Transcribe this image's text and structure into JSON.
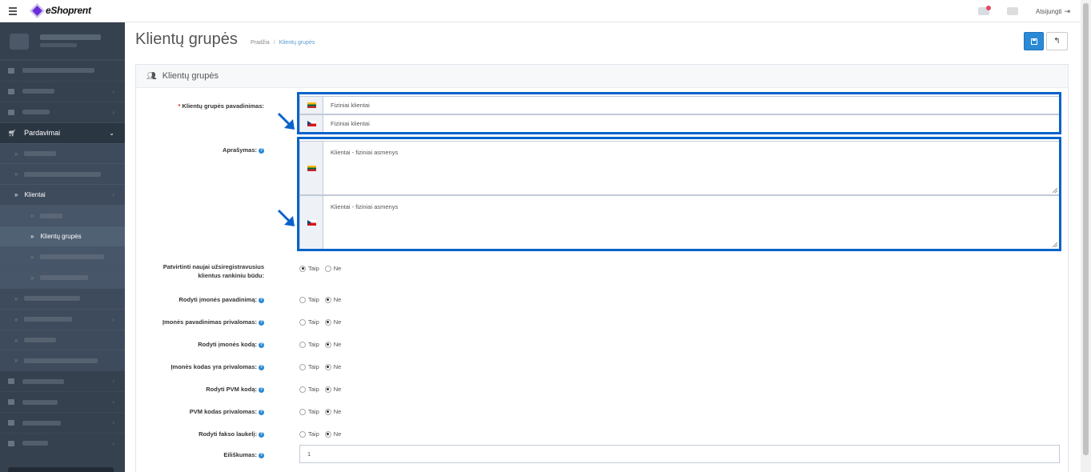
{
  "app": {
    "logo_text": "eShoprent",
    "logout_label": "Atsijungti"
  },
  "sidebar": {
    "open_section_label": "Pardavimai",
    "clients_label": "Klientai",
    "active_item_label": "Klientų grupės"
  },
  "page": {
    "title": "Klientų grupės",
    "breadcrumb": {
      "home": "Pradžia",
      "separator": "/",
      "current": "Klientų grupės"
    }
  },
  "panel": {
    "title": "Klientų grupės"
  },
  "form": {
    "name_label": "Klientų grupės pavadinimas:",
    "name_required_mark": "*",
    "name_values": {
      "lt": "Fiziniai klientai",
      "cz": "Fiziniai klientai"
    },
    "description_label": "Aprašymas:",
    "description_values": {
      "lt": "Klientai - fiziniai asmenys",
      "cz": "Klientai - fiziniai asmenys"
    },
    "yes_label": "Taip",
    "no_label": "Ne",
    "approve_label_line1": "Patvirtinti naujai užsiregistravusius",
    "approve_label_line2": "klientus rankiniu būdu:",
    "radio_rows": [
      {
        "label": "Rodyti įmonės pavadinimą:",
        "value": "no"
      },
      {
        "label": "Įmonės pavadinimas privalomas:",
        "value": "no"
      },
      {
        "label": "Rodyti įmonės kodą:",
        "value": "no"
      },
      {
        "label": "Įmonės kodas yra privalomas:",
        "value": "no"
      },
      {
        "label": "Rodyti PVM kodą:",
        "value": "no"
      },
      {
        "label": "PVM kodas privalomas:",
        "value": "no"
      },
      {
        "label": "Rodyti fakso laukelį:",
        "value": "no"
      }
    ],
    "sort_label": "Eiliškumas:",
    "sort_value": "1"
  },
  "colors": {
    "sidebar_bg": "#364150",
    "accent_blue": "#2b8ad6",
    "highlight": "#0a63c9"
  }
}
